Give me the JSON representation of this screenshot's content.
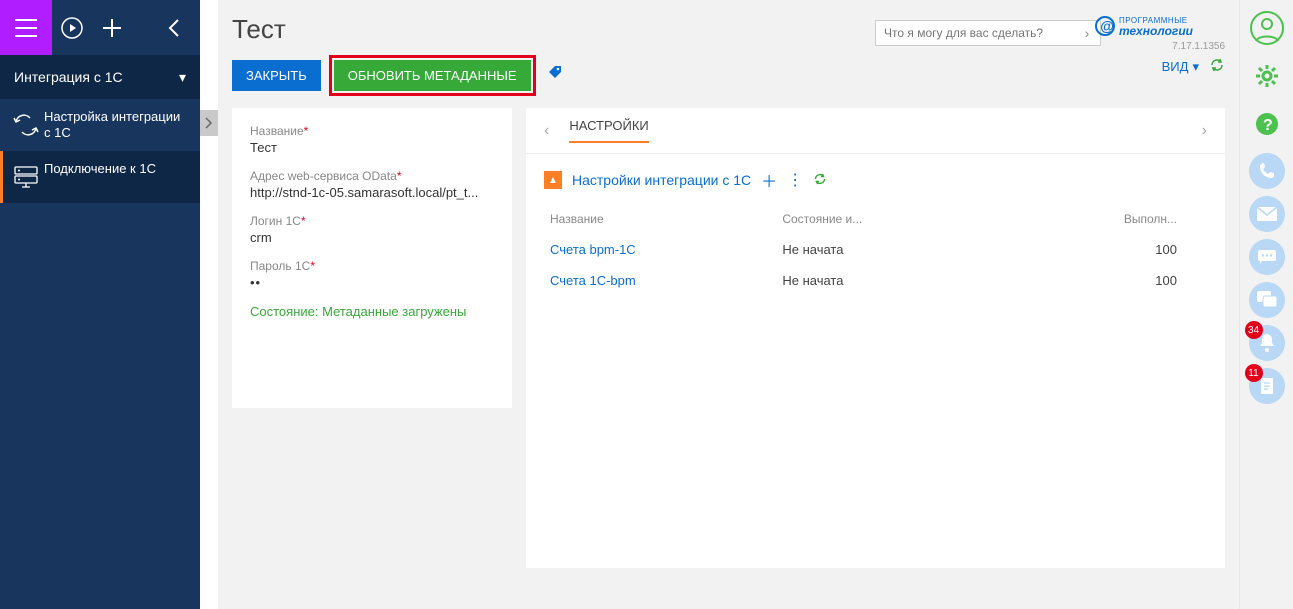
{
  "topbar": {},
  "sidebar": {
    "section": "Интеграция с 1С",
    "items": [
      {
        "label": "Настройка интеграции с 1С"
      },
      {
        "label": "Подключение к 1С"
      }
    ]
  },
  "header": {
    "title": "Тест",
    "search_placeholder": "Что я могу для вас сделать?",
    "logo_line1": "ПРОГРАММНЫЕ",
    "logo_line2": "технологии",
    "version": "7.17.1.1356"
  },
  "toolbar": {
    "close": "ЗАКРЫТЬ",
    "update_meta": "ОБНОВИТЬ МЕТАДАННЫЕ",
    "view": "ВИД"
  },
  "form": {
    "name_label": "Название",
    "name_value": "Тест",
    "odata_label": "Адрес web-сервиса OData",
    "odata_value": "http://stnd-1c-05.samarasoft.local/pt_t...",
    "login_label": "Логин 1С",
    "login_value": "crm",
    "pass_label": "Пароль 1С",
    "pass_value": "••",
    "status": "Состояние: Метаданные загружены"
  },
  "detail": {
    "tab": "НАСТРОЙКИ",
    "subheader": "Настройки интеграции с 1С",
    "columns": [
      "Название",
      "Состояние и...",
      "Выполн..."
    ],
    "rows": [
      {
        "name": "Счета bpm-1C",
        "state": "Не начата",
        "done": "100"
      },
      {
        "name": "Счета 1С-bpm",
        "state": "Не начата",
        "done": "100"
      }
    ]
  },
  "rail": {
    "badges": {
      "bell": "34",
      "doc": "11"
    }
  }
}
